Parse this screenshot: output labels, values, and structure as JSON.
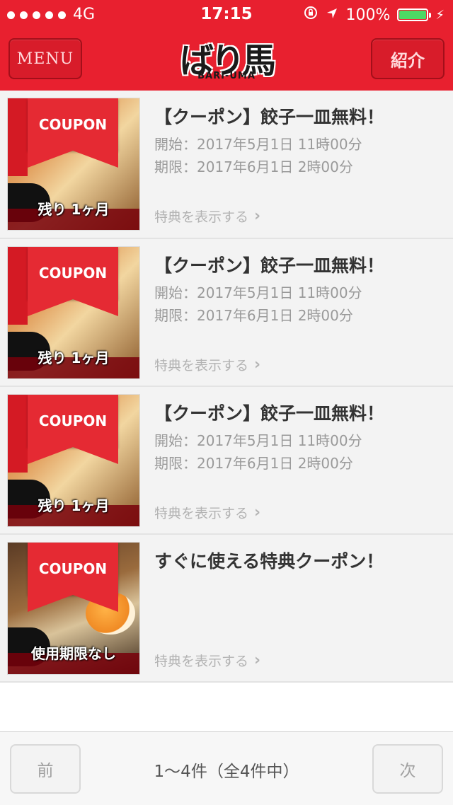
{
  "status_bar": {
    "carrier": "4G",
    "time": "17:15",
    "battery": "100%",
    "battery_level": 1.0
  },
  "header": {
    "menu_label": "MENU",
    "intro_label": "紹介",
    "logo_text": "ばり馬",
    "logo_sub": "BARI-UMA"
  },
  "coupons": [
    {
      "badge": "COUPON",
      "overlay": "残り 1ヶ月",
      "title": "【クーポン】餃子一皿無料！",
      "start": "開始：2017年5月1日 11時00分",
      "end": "期限：2017年6月1日 2時00分",
      "link": "特典を表示する"
    },
    {
      "badge": "COUPON",
      "overlay": "残り 1ヶ月",
      "title": "【クーポン】餃子一皿無料！",
      "start": "開始：2017年5月1日 11時00分",
      "end": "期限：2017年6月1日 2時00分",
      "link": "特典を表示する"
    },
    {
      "badge": "COUPON",
      "overlay": "残り 1ヶ月",
      "title": "【クーポン】餃子一皿無料！",
      "start": "開始：2017年5月1日 11時00分",
      "end": "期限：2017年6月1日 2時00分",
      "link": "特典を表示する"
    },
    {
      "badge": "COUPON",
      "overlay": "使用期限なし",
      "title": "すぐに使える特典クーポン！",
      "start": "",
      "end": "",
      "link": "特典を表示する"
    }
  ],
  "footer": {
    "prev_label": "前",
    "next_label": "次",
    "count_text": "1〜4件（全4件中）"
  },
  "colors": {
    "brand_red": "#e8202f",
    "row_bg": "#f3f3f3",
    "muted_text": "#9a9a9a"
  },
  "icons": [
    "signal-dots-icon",
    "orientation-lock-icon",
    "location-arrow-icon",
    "battery-icon",
    "charging-bolt-icon",
    "chevron-right-icon"
  ]
}
